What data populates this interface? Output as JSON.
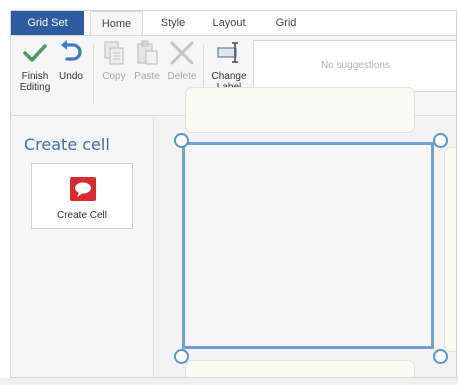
{
  "tabs": {
    "gridset": "Grid Set",
    "home": "Home",
    "style": "Style",
    "layout": "Layout",
    "grid": "Grid"
  },
  "ribbon": {
    "finish_label": "Finish Editing",
    "undo_label": "Undo",
    "copy_label": "Copy",
    "paste_label": "Paste",
    "delete_label": "Delete",
    "change_label": "Change Label",
    "suggestions_placeholder": "No suggestions"
  },
  "left_panel": {
    "title": "Create cell",
    "create_cell_label": "Create Cell"
  },
  "colors": {
    "accent": "#2f5c9e",
    "selection": "#6fa0d6",
    "finish_green": "#4c9a6a",
    "undo_blue": "#3e7ac1",
    "create_icon_red": "#d62b2f"
  },
  "icons": {
    "finish": "checkmark-icon",
    "undo": "undo-arrow-icon",
    "copy": "copy-icon",
    "paste": "paste-icon",
    "delete": "x-icon",
    "change_label": "label-edit-icon",
    "create_cell": "speech-bubble-icon"
  }
}
